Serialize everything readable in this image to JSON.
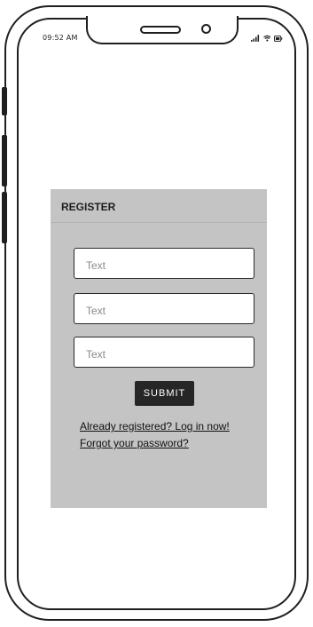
{
  "status_bar": {
    "time": "09:52 AM",
    "icons": [
      "signal-icon",
      "wifi-icon",
      "battery-icon"
    ]
  },
  "register": {
    "title": "REGISTER",
    "fields": [
      {
        "placeholder": "Text",
        "value": ""
      },
      {
        "placeholder": "Text",
        "value": ""
      },
      {
        "placeholder": "Text",
        "value": ""
      }
    ],
    "submit_label": "SUBMIT",
    "login_link": "Already registered? Log in now!",
    "forgot_link": "Forgot your password?"
  },
  "colors": {
    "panel_bg": "#c4c4c4",
    "button_bg": "#262626",
    "frame": "#1f1f1f"
  }
}
